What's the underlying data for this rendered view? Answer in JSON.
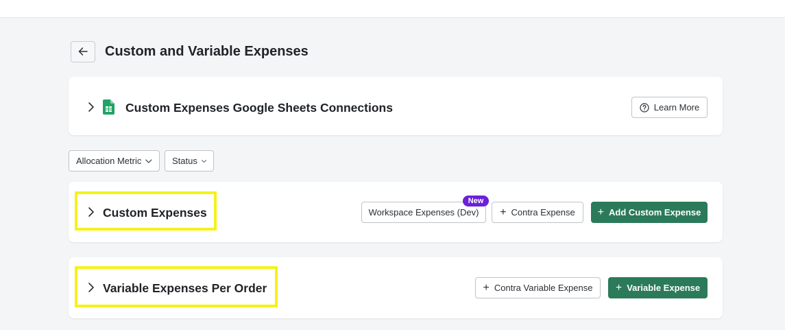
{
  "page": {
    "title": "Custom and Variable Expenses"
  },
  "sheets_card": {
    "title": "Custom Expenses Google Sheets Connections",
    "learn_more_label": "Learn More"
  },
  "filters": {
    "allocation_metric_label": "Allocation Metric",
    "status_label": "Status"
  },
  "custom_card": {
    "title": "Custom Expenses",
    "workspace_button_label": "Workspace Expenses (Dev)",
    "new_badge_label": "New",
    "contra_button_label": "Contra Expense",
    "add_button_label": "Add Custom Expense"
  },
  "variable_card": {
    "title": "Variable Expenses Per Order",
    "contra_button_label": "Contra Variable Expense",
    "add_button_label": "Variable Expense"
  },
  "colors": {
    "primary": "#2b7a5a",
    "badge": "#6b21d8",
    "highlight": "#f5f219",
    "background": "#f4f5f7"
  },
  "icons": [
    "arrow-left-icon",
    "chevron-right-icon",
    "google-sheets-icon",
    "help-circle-icon",
    "chevron-down-icon",
    "plus-icon"
  ]
}
